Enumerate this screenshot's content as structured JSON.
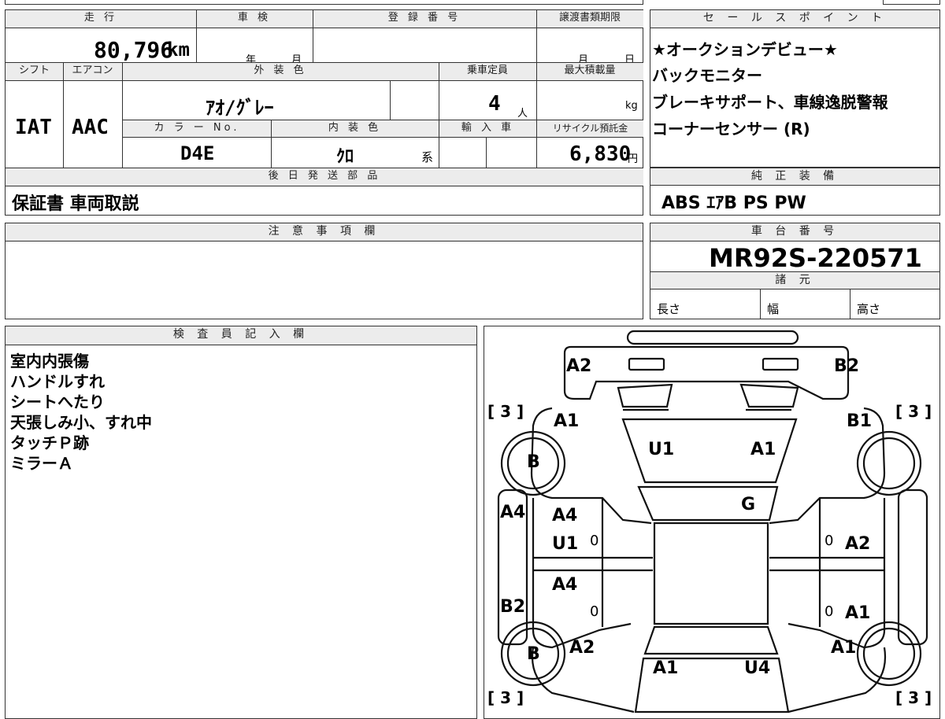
{
  "vehicle_info": {
    "mileage_label": "走 行",
    "mileage_value": "80,796",
    "mileage_unit": "km",
    "inspection_label": "車 検",
    "inspection_year": "年",
    "inspection_month": "月",
    "registration_label": "登 録 番 号",
    "transfer_deadline_label": "譲渡書類期限",
    "transfer_month": "月",
    "transfer_day": "日",
    "shift_label": "シフト",
    "aircon_label": "エアコン",
    "exterior_color_label": "外 装 色",
    "capacity_label": "乗車定員",
    "max_load_label": "最大積載量",
    "shift_value": "IAT",
    "aircon_value": "AAC",
    "exterior_color_value": "ｱｵ/ｸﾞﾚｰ",
    "capacity_value": "4",
    "capacity_unit": "人",
    "max_load_unit": "kg",
    "color_no_label": "カ ラ ー No.",
    "interior_color_label": "内 装 色",
    "import_label": "輸 入 車",
    "recycle_label": "リサイクル預託金",
    "color_no_value": "D4E",
    "interior_color_value": "ｸﾛ",
    "interior_color_suffix": "系",
    "recycle_value": "6,830",
    "recycle_unit": "円",
    "later_parts_label": "後 日 発 送 部 品",
    "later_parts_value": "保証書 車両取説"
  },
  "sales_points": {
    "label": "セ ー ル ス ポ イ ン ト",
    "lines": [
      "★オークションデビュー★",
      "バックモニター",
      "ブレーキサポート、車線逸脱警報",
      "コーナーセンサー (R)"
    ]
  },
  "factory_equipment": {
    "label": "純 正 装 備",
    "value": "ABS ｴｱB PS PW"
  },
  "notes": {
    "label": "注 意 事 項 欄"
  },
  "chassis": {
    "label": "車 台 番 号",
    "value": "MR92S-220571",
    "specs_label": "諸 元",
    "length_label": "長さ",
    "width_label": "幅",
    "height_label": "高さ"
  },
  "inspector": {
    "label": "検 査 員 記 入 欄",
    "lines": [
      "室内内張傷",
      "ハンドルすれ",
      "シートへたり",
      "天張しみ小、すれ中",
      "タッチＰ跡",
      "ミラーＡ"
    ]
  },
  "damage_map": {
    "tire_front_left": "[ 3 ]",
    "tire_front_right": "[ 3 ]",
    "tire_rear_left": "[ 3 ]",
    "tire_rear_right": "[ 3 ]",
    "marks": {
      "front_bumper_left": "A2",
      "front_bumper_right": "B2",
      "fender_front_left": "A1",
      "fender_front_right": "B1",
      "bonnet_left": "U1",
      "bonnet_right": "A1",
      "wheel_front_left": "B",
      "windshield": "G",
      "side_left_outer": "A4",
      "door_front_left_a": "A4",
      "door_front_left_b": "U1",
      "door_front_left_zero": "0",
      "door_front_right_zero": "0",
      "door_front_right": "A2",
      "door_rear_left": "A4",
      "sill_left": "B2",
      "door_rear_left_zero": "0",
      "door_rear_right_zero": "0",
      "door_rear_right": "A1",
      "wheel_rear_left": "B",
      "quarter_rear_left": "A2",
      "quarter_rear_right": "A1",
      "trunk_left": "A1",
      "trunk_right": "U4"
    }
  }
}
